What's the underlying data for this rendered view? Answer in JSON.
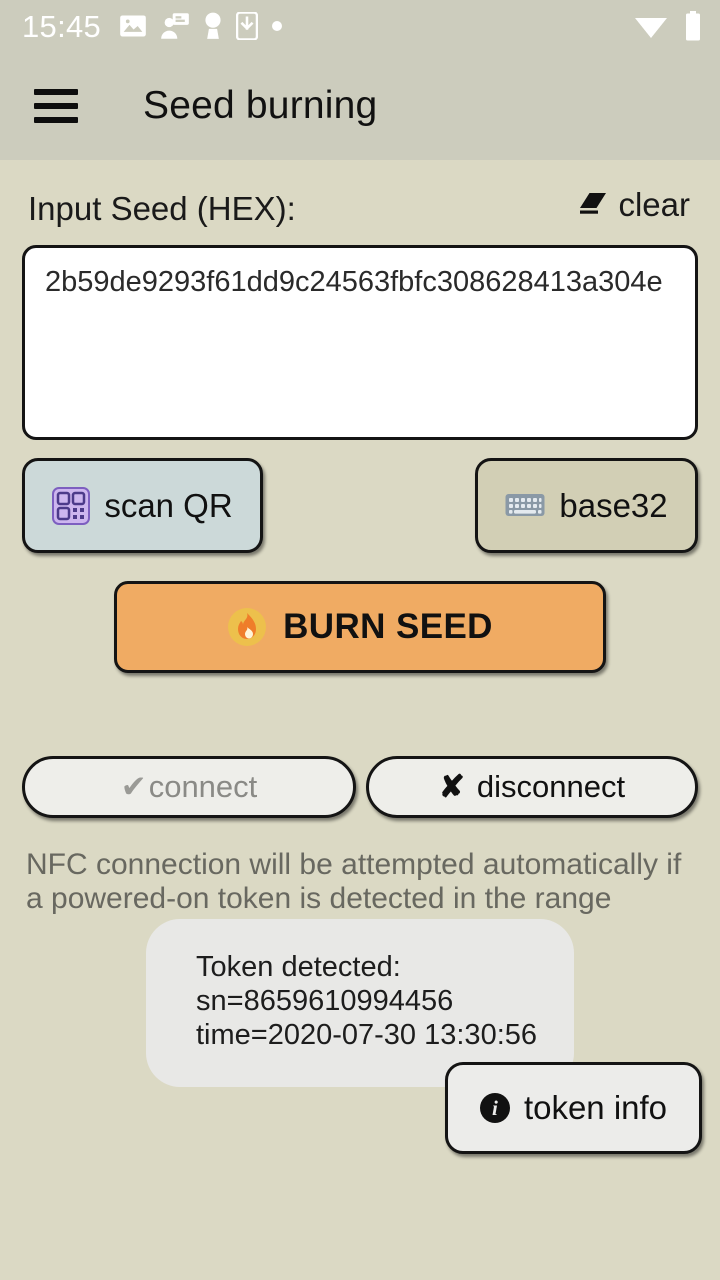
{
  "statusbar": {
    "clock": "15:45",
    "left_icons": [
      "image-icon",
      "screen-share-person-icon",
      "key-icon",
      "phone-download-icon",
      "dot-icon"
    ],
    "right_icons": [
      "wifi-icon",
      "battery-icon"
    ],
    "icon_color": "#ffffff",
    "background": "#ccccbd"
  },
  "appbar": {
    "menu_icon": "hamburger-menu-icon",
    "title": "Seed burning",
    "background": "#ccccbd"
  },
  "seed_section": {
    "label": "Input Seed (HEX):",
    "clear_icon": "eraser-icon",
    "clear_label": "clear",
    "input_value": "2b59de9293f61dd9c24563fbfc308628413a304e",
    "input_placeholder": ""
  },
  "encoding_buttons": {
    "scan_qr": {
      "icon": "qr-code-icon",
      "label": "scan QR",
      "background": "#ccd9d9"
    },
    "base32": {
      "icon": "keyboard-icon",
      "label": "base32",
      "background": "#d2cfb5"
    }
  },
  "burn_button": {
    "icon": "fire-icon",
    "label": "BURN SEED",
    "background": "#f0ab63"
  },
  "nfc": {
    "connect": {
      "icon": "check-icon",
      "label": "connect",
      "enabled": false
    },
    "disconnect": {
      "icon": "cross-icon",
      "label": "disconnect",
      "enabled": true
    },
    "hint": "NFC connection will be attempted automatically if a powered-on token is detected in the range"
  },
  "toast": {
    "line1": "Token detected:",
    "line2": "sn=8659610994456",
    "line3": "time=2020-07-30 13:30:56"
  },
  "token_info_button": {
    "icon": "info-icon",
    "label": "token info"
  },
  "theme": {
    "page_background": "#dbd9c4",
    "bar_background": "#ccccbd",
    "accent_orange": "#f0ab63",
    "hint_text": "#686860"
  }
}
